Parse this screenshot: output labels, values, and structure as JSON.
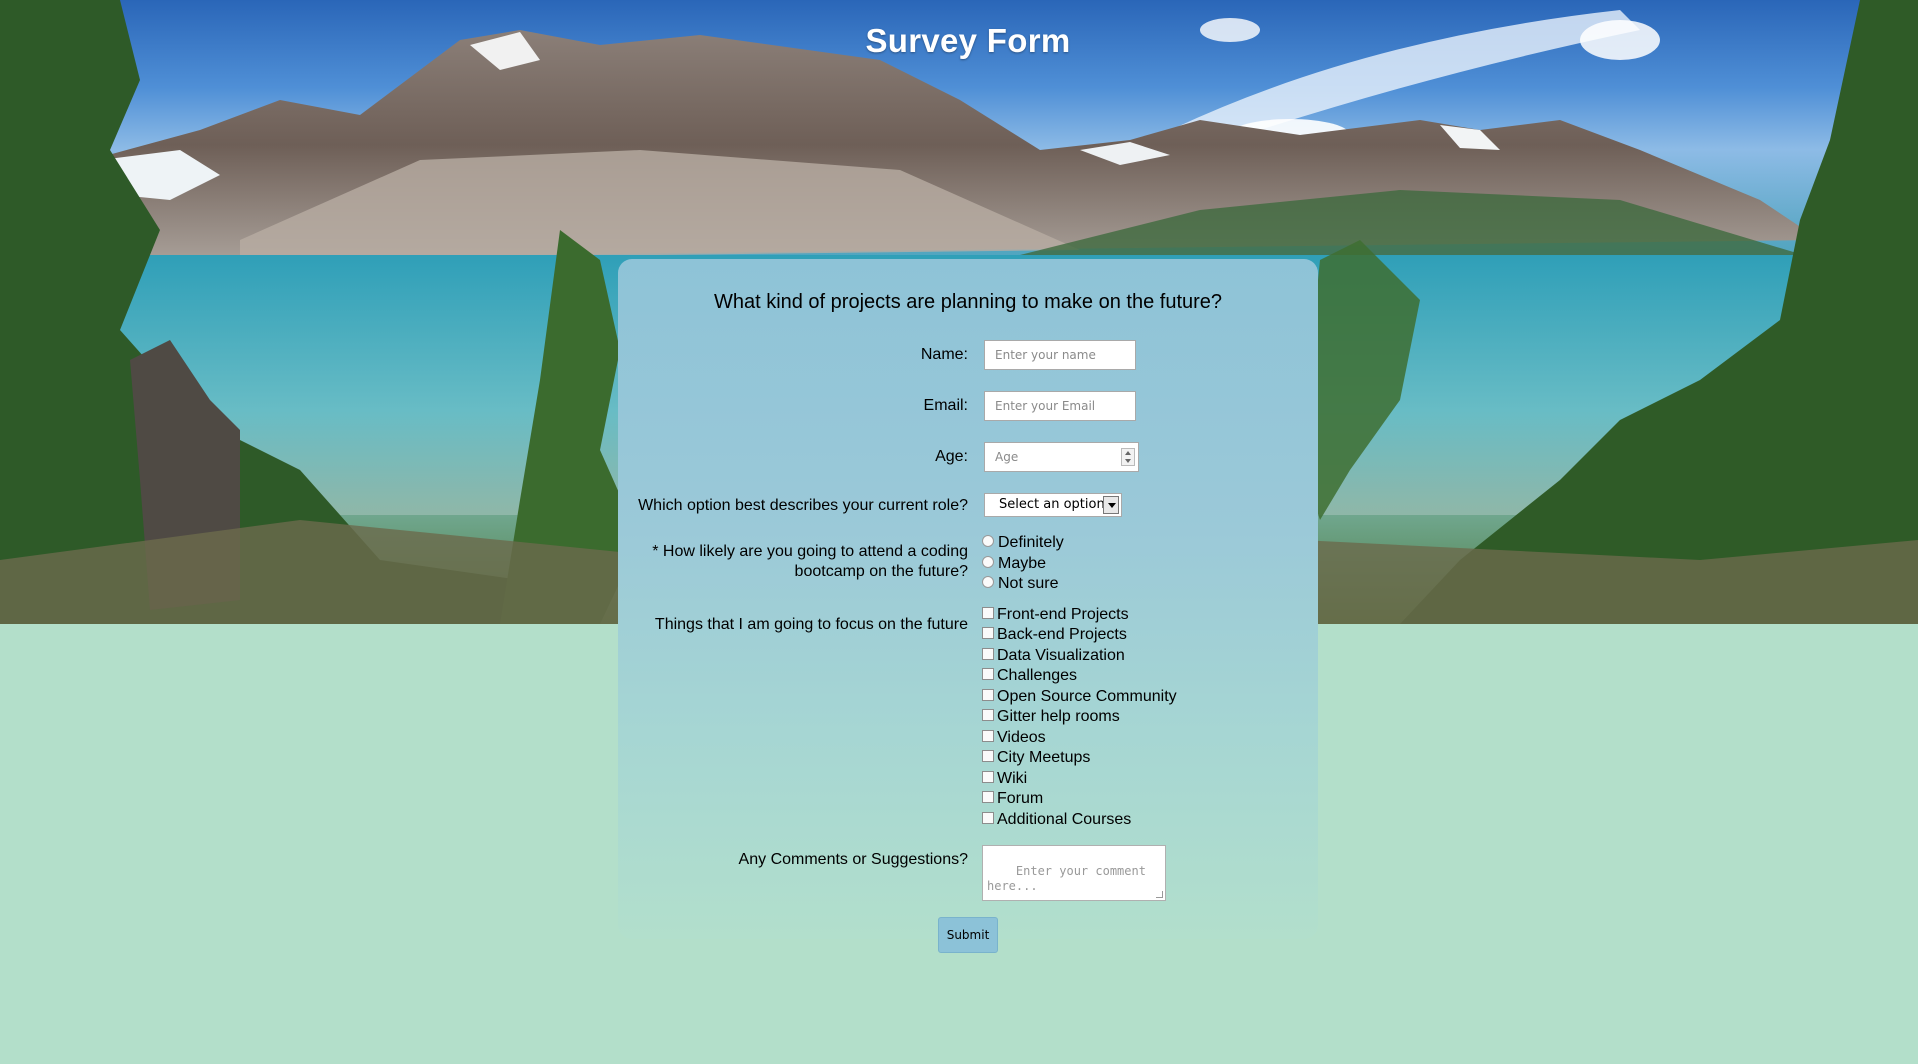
{
  "page": {
    "title": "Survey Form"
  },
  "form": {
    "question": "What kind of projects are planning to make on the future?",
    "name": {
      "label": "Name:",
      "placeholder": "Enter your name"
    },
    "email": {
      "label": "Email:",
      "placeholder": "Enter your Email"
    },
    "age": {
      "label": "Age:",
      "placeholder": "Age"
    },
    "role": {
      "label": "Which option best describes your current role?",
      "selected": "Select an option"
    },
    "bootcamp": {
      "label_line1": "* How likely are you going to attend a coding",
      "label_line2": "bootcamp on the future?",
      "options": [
        "Definitely",
        "Maybe",
        "Not sure"
      ]
    },
    "focus": {
      "label": "Things that I am going to focus on the future",
      "options": [
        "Front-end Projects",
        "Back-end Projects",
        "Data Visualization",
        "Challenges",
        "Open Source Community",
        "Gitter help rooms",
        "Videos",
        "City Meetups",
        "Wiki",
        "Forum",
        "Additional Courses"
      ]
    },
    "comments": {
      "label": "Any Comments or Suggestions?",
      "placeholder": "Enter your comment here..."
    },
    "submit_label": "Submit"
  },
  "colors": {
    "page_bg": "#b3dfca",
    "card_top": "#8ec3d7",
    "card_bottom": "#b2dfcc",
    "submit_bg": "#8cc2d8"
  }
}
